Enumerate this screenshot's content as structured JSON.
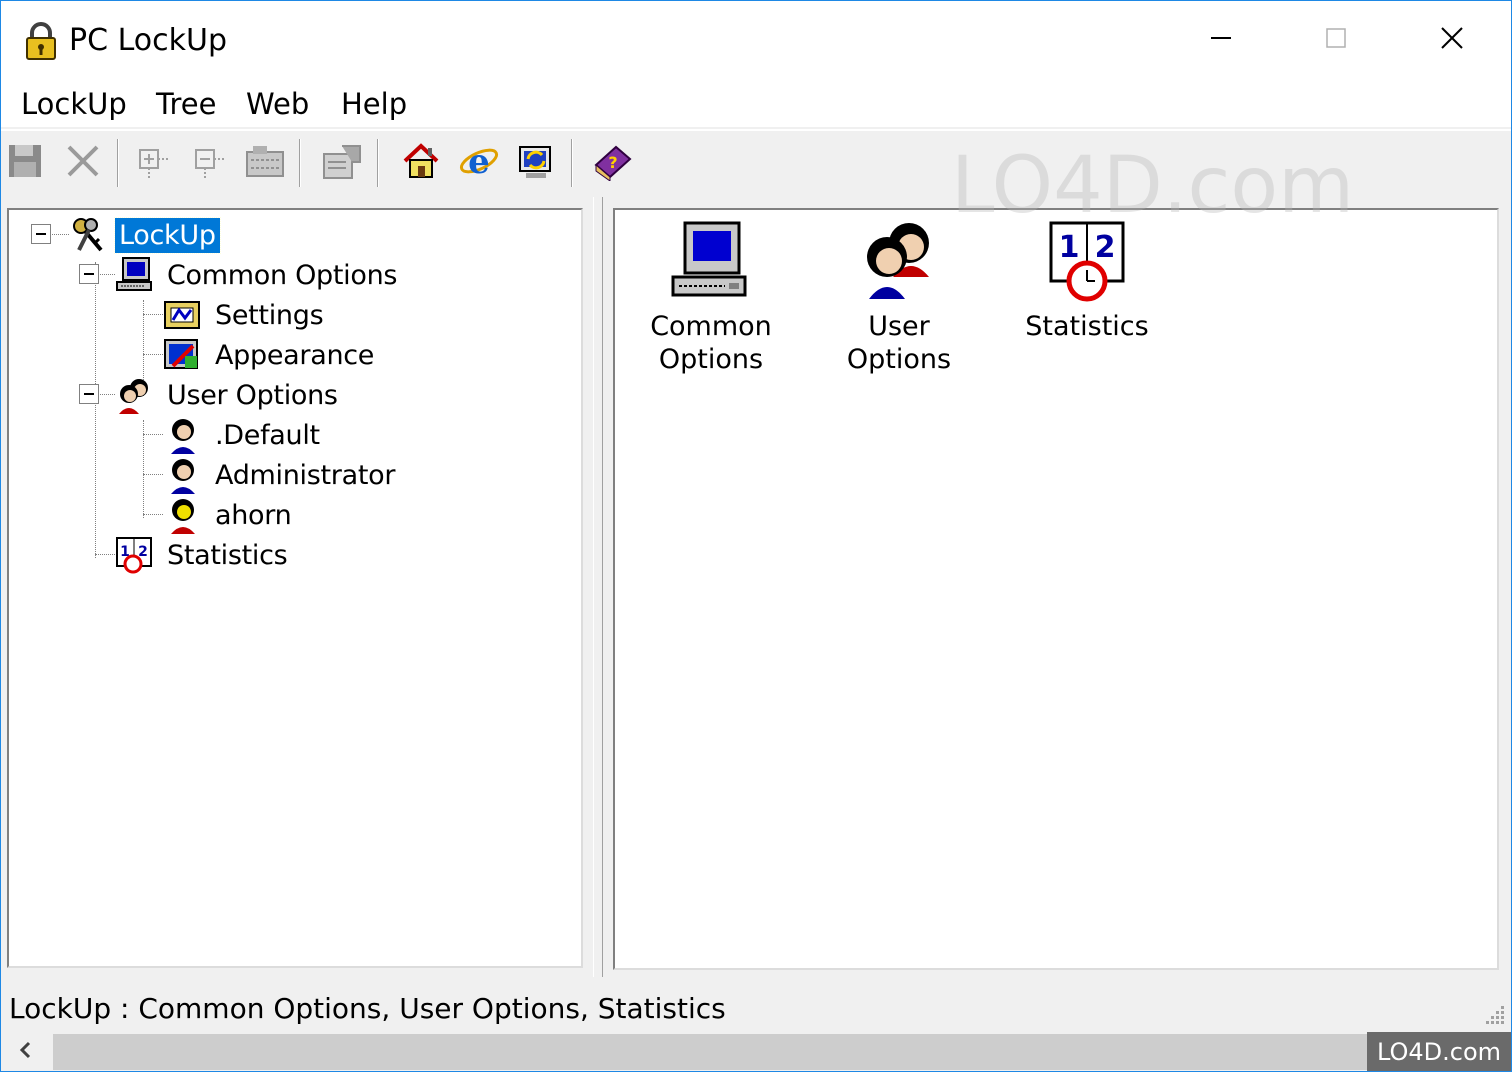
{
  "window": {
    "title": "PC LockUp",
    "icons": {
      "app": "padlock-icon",
      "minimize": "minimize-icon",
      "maximize": "maximize-icon",
      "close": "close-icon"
    }
  },
  "menu": {
    "items": [
      {
        "label": "LockUp"
      },
      {
        "label": "Tree"
      },
      {
        "label": "Web"
      },
      {
        "label": "Help"
      }
    ]
  },
  "toolbar": {
    "buttons": [
      {
        "name": "save",
        "icon": "floppy-disk-icon",
        "enabled": false
      },
      {
        "name": "delete",
        "icon": "x-icon",
        "enabled": false
      },
      {
        "name": "expand",
        "icon": "expand-tree-icon",
        "enabled": false
      },
      {
        "name": "collapse",
        "icon": "collapse-tree-icon",
        "enabled": false
      },
      {
        "name": "view",
        "icon": "grid-icon",
        "enabled": false
      },
      {
        "name": "properties",
        "icon": "properties-icon",
        "enabled": false
      },
      {
        "name": "home",
        "icon": "house-icon",
        "enabled": true
      },
      {
        "name": "internet-explorer",
        "icon": "ie-icon",
        "enabled": true
      },
      {
        "name": "refresh",
        "icon": "refresh-icon",
        "enabled": true
      },
      {
        "name": "help-book",
        "icon": "help-book-icon",
        "enabled": true
      }
    ]
  },
  "tree": {
    "root": {
      "label": "LockUp",
      "icon": "keys-icon",
      "selected": true
    },
    "common_options": {
      "label": "Common Options",
      "icon": "computer-icon"
    },
    "settings": {
      "label": "Settings",
      "icon": "settings-icon"
    },
    "appearance": {
      "label": "Appearance",
      "icon": "appearance-icon"
    },
    "user_options": {
      "label": "User Options",
      "icon": "users-icon"
    },
    "default_user": {
      "label": ".Default",
      "icon": "user-icon"
    },
    "administrator": {
      "label": "Administrator",
      "icon": "user-icon"
    },
    "ahorn": {
      "label": "ahorn",
      "icon": "user-yellow-icon"
    },
    "statistics": {
      "label": "Statistics",
      "icon": "statistics-icon"
    }
  },
  "list": {
    "items": [
      {
        "line1": "Common",
        "line2": "Options",
        "icon": "computer-icon"
      },
      {
        "line1": "User Options",
        "line2": "",
        "icon": "users-icon"
      },
      {
        "line1": "Statistics",
        "line2": "",
        "icon": "statistics-icon"
      }
    ]
  },
  "status": {
    "text": "LockUp : Common Options, User Options, Statistics"
  },
  "watermark": {
    "text": "LO4D.com"
  },
  "colors": {
    "selection": "#0078d7",
    "window_border": "#1e88e5",
    "chrome": "#f0f0f0"
  }
}
